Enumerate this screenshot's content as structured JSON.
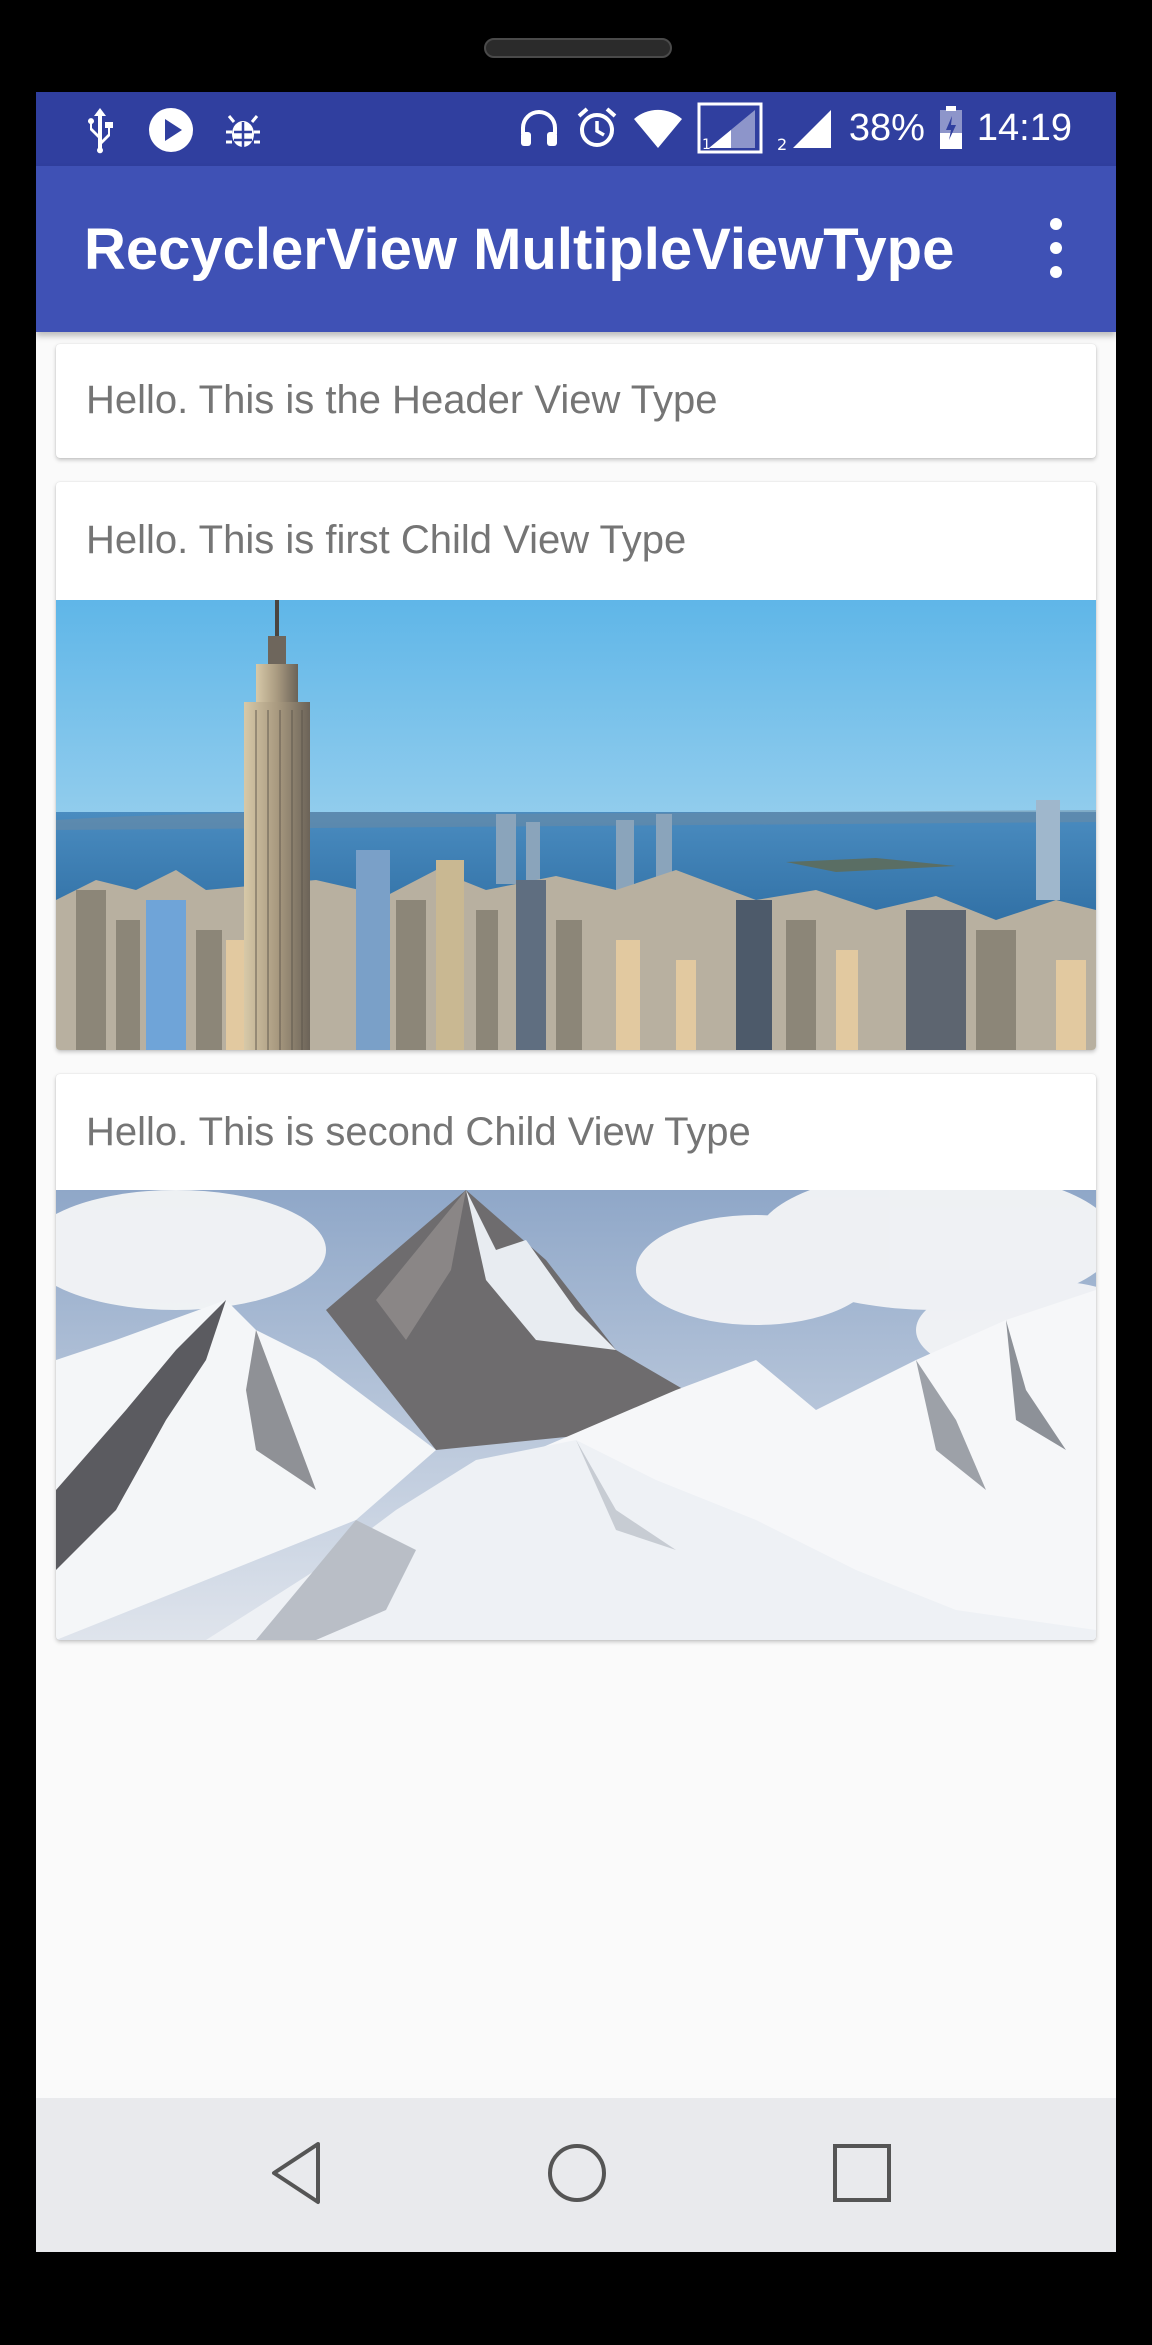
{
  "status_bar": {
    "battery": "38%",
    "time": "14:19",
    "left_icons": [
      "usb-icon",
      "play-icon",
      "debug-bug-icon"
    ],
    "right_icons": [
      "headphones-icon",
      "alarm-icon",
      "wifi-icon",
      "sim1-signal-icon",
      "sim2-signal-icon",
      "battery-icon"
    ]
  },
  "toolbar": {
    "title": "RecyclerView MultipleViewType",
    "overflow_icon": "more-vert-icon"
  },
  "list": {
    "header": {
      "text": "Hello. This is the Header View Type"
    },
    "child1": {
      "text": "Hello. This is first Child View Type",
      "image": "city-skyline-image"
    },
    "child2": {
      "text": "Hello. This is second Child View Type",
      "image": "snowy-mountains-image"
    }
  },
  "navigation_bar": {
    "buttons": [
      "back-icon",
      "home-icon",
      "recents-icon"
    ]
  },
  "colors": {
    "status_bar": "#303f9f",
    "toolbar": "#3f51b5",
    "background": "#fafafa",
    "card_text": "#757575",
    "nav_bar": "#e9eaed"
  }
}
